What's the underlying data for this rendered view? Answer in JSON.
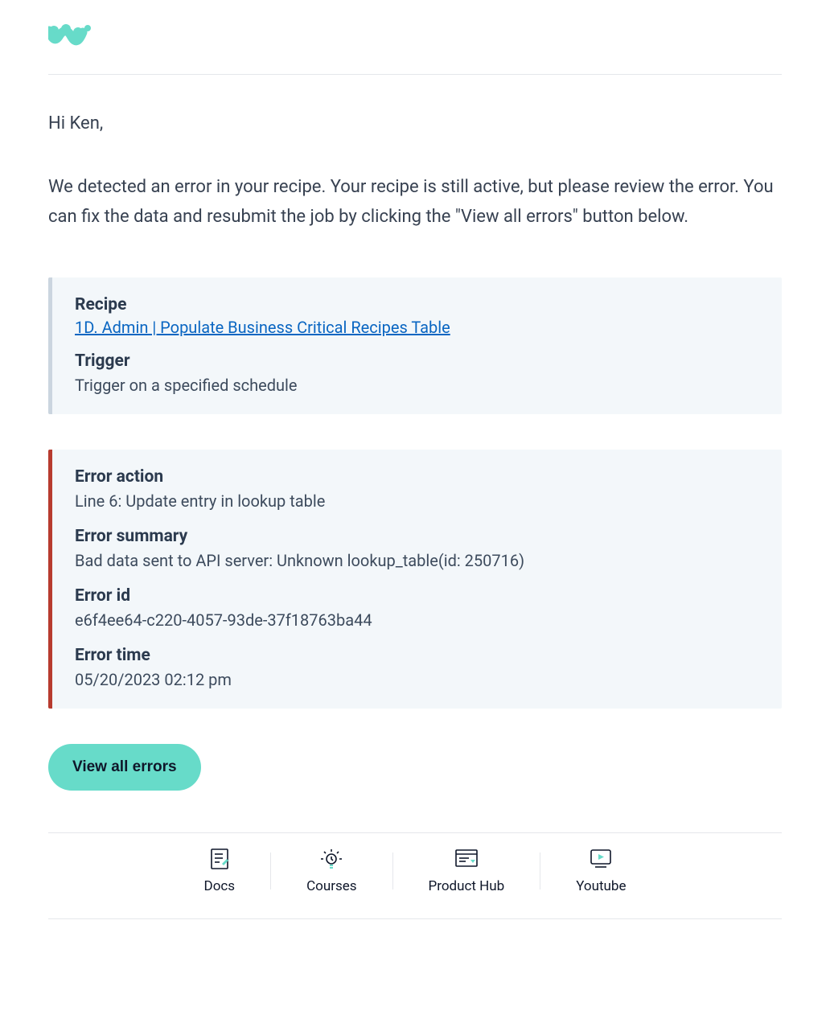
{
  "greeting": "Hi Ken,",
  "intro": "We detected an error in your recipe. Your recipe is still active, but please review the error. You can fix the data and resubmit the job by clicking the \"View all errors\" button below.",
  "recipe_card": {
    "recipe_label": "Recipe",
    "recipe_link_text": "1D. Admin | Populate Business Critical Recipes Table",
    "trigger_label": "Trigger",
    "trigger_value": "Trigger on a specified schedule"
  },
  "error_card": {
    "action_label": "Error action",
    "action_value": "Line 6: Update entry in lookup table",
    "summary_label": "Error summary",
    "summary_value": "Bad data sent to API server: Unknown lookup_table(id: 250716)",
    "id_label": "Error id",
    "id_value": "e6f4ee64-c220-4057-93de-37f18763ba44",
    "time_label": "Error time",
    "time_value": "05/20/2023 02:12 pm"
  },
  "cta_label": "View all errors",
  "footer": {
    "docs": "Docs",
    "courses": "Courses",
    "product_hub": "Product Hub",
    "youtube": "Youtube"
  }
}
